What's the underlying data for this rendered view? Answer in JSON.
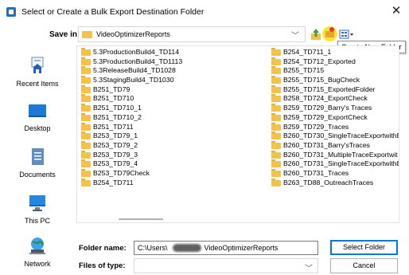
{
  "window": {
    "title": "Select or Create a Bulk Export Destination Folder",
    "close_label": "✕"
  },
  "toolbar": {
    "save_in_label": "Save in:",
    "save_in_value": "VideoOptimizerReports",
    "tooltip": "Create New Folder"
  },
  "places": [
    {
      "label": "Recent Items",
      "icon": "recent-items-icon"
    },
    {
      "label": "Desktop",
      "icon": "desktop-icon"
    },
    {
      "label": "Documents",
      "icon": "documents-icon"
    },
    {
      "label": "This PC",
      "icon": "this-pc-icon"
    },
    {
      "label": "Network",
      "icon": "network-icon"
    }
  ],
  "files": {
    "column_1": [
      "5.3ProductionBuild4_TD114",
      "5.3ProductionBuild4_TD1113",
      "5.3ReleaseBuild4_TD1028",
      "5.3StagingBuild4_TD1030",
      "B251_TD79",
      "B251_TD710",
      "B251_TD710_1",
      "B251_TD710_2",
      "B251_TD711",
      "B253_TD79_1",
      "B253_TD79_2",
      "B253_TD79_3",
      "B253_TD79_4",
      "B253_TD79Check",
      "B254_TD711"
    ],
    "column_2": [
      "B254_TD711_1",
      "B254_TD712_Exported",
      "B255_TD715",
      "B255_TD715_BugCheck",
      "B255_TD715_ExportedFolder",
      "B258_TD724_ExportCheck",
      "B259_TD729_Barry's Traces",
      "B259_TD729_ExportCheck",
      "B259_TD729_Traces",
      "B260_TD730_SingleTraceExportwithE",
      "B260_TD731_Barry'sTraces",
      "B260_TD731_MultipleTraceExportwit",
      "B260_TD731_SingleTraceExportwithE",
      "B260_TD731_Traces",
      "B263_TD88_OutreachTraces"
    ]
  },
  "footer": {
    "folder_name_label": "Folder name:",
    "folder_name_prefix": "C:\\Users\\",
    "folder_name_suffix": "VideoOptimizerReports",
    "files_of_type_label": "Files of type:",
    "files_of_type_value": "",
    "select_button": "Select Folder",
    "cancel_button": "Cancel"
  },
  "colors": {
    "folder": "#f3c24b",
    "primary_border": "#0078d7",
    "tooltip_border": "#8a8a8a"
  }
}
